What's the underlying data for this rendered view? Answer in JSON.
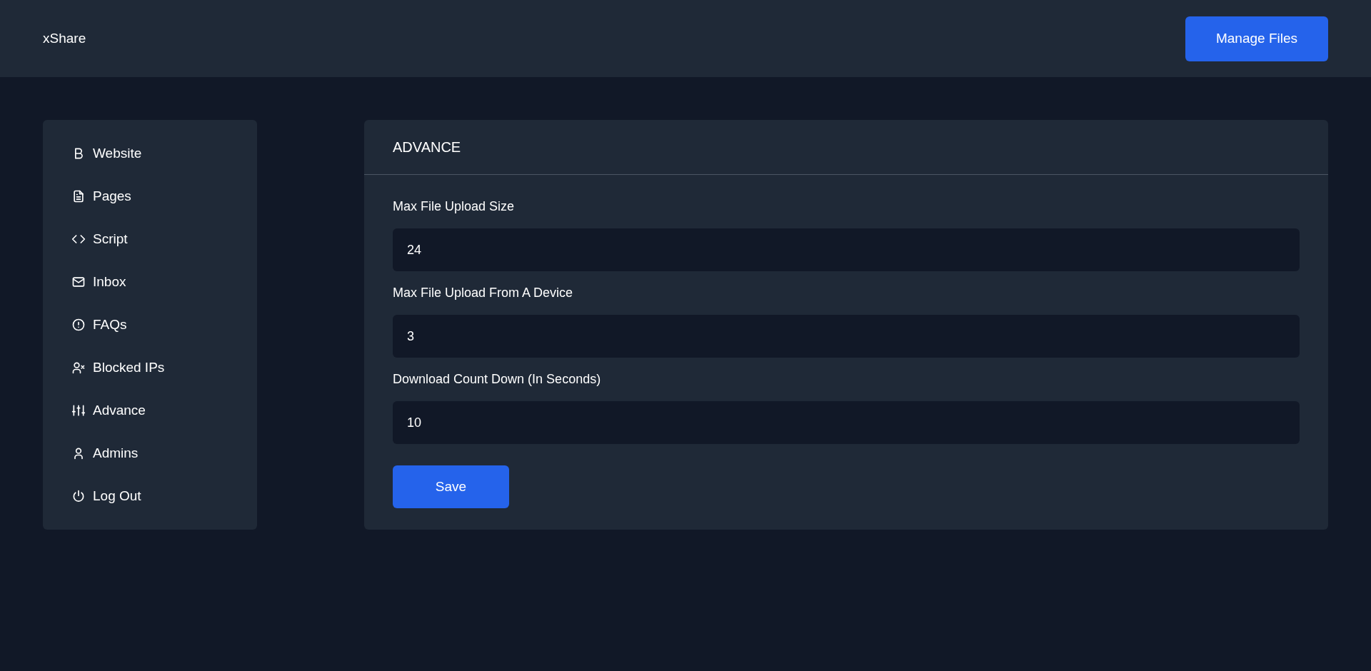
{
  "header": {
    "logo": "xShare",
    "button": "Manage Files"
  },
  "sidebar": {
    "items": [
      {
        "label": "Website",
        "kind": "website"
      },
      {
        "label": "Pages",
        "kind": "pages"
      },
      {
        "label": "Script",
        "kind": "script"
      },
      {
        "label": "Inbox",
        "kind": "inbox"
      },
      {
        "label": "FAQs",
        "kind": "faqs"
      },
      {
        "label": "Blocked IPs",
        "kind": "blocked"
      },
      {
        "label": "Advance",
        "kind": "advance"
      },
      {
        "label": "Admins",
        "kind": "admins"
      },
      {
        "label": "Log Out",
        "kind": "logout"
      }
    ]
  },
  "panel": {
    "title": "ADVANCE",
    "fields": [
      {
        "label": "Max File Upload Size",
        "value": "24"
      },
      {
        "label": "Max File Upload From A Device",
        "value": "3"
      },
      {
        "label": "Download Count Down (In Seconds)",
        "value": "10"
      }
    ],
    "button": "Save"
  }
}
